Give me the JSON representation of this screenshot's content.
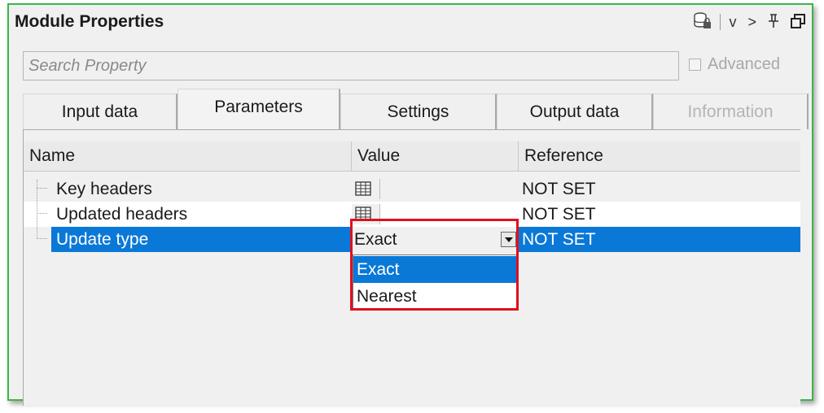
{
  "window": {
    "title": "Module Properties"
  },
  "titlebar_icons": [
    {
      "name": "database-lock-icon"
    },
    {
      "name": "chevron-down-icon",
      "glyph": "v"
    },
    {
      "name": "chevron-right-icon",
      "glyph": ">"
    },
    {
      "name": "pin-icon",
      "glyph": "⊥"
    },
    {
      "name": "restore-window-icon",
      "glyph": "❐"
    }
  ],
  "search": {
    "placeholder": "Search Property",
    "value": ""
  },
  "advanced": {
    "label": "Advanced",
    "checked": false,
    "enabled": false
  },
  "tabs": [
    {
      "label": "Input data",
      "active": false,
      "enabled": true
    },
    {
      "label": "Parameters",
      "active": true,
      "enabled": true
    },
    {
      "label": "Settings",
      "active": false,
      "enabled": true
    },
    {
      "label": "Output data",
      "active": false,
      "enabled": true
    },
    {
      "label": "Information",
      "active": false,
      "enabled": false
    }
  ],
  "grid": {
    "columns": [
      "Name",
      "Value",
      "Reference"
    ],
    "rows": [
      {
        "name": "Key headers",
        "value_type": "table-editor",
        "reference": "NOT SET",
        "selected": false
      },
      {
        "name": "Updated headers",
        "value_type": "table-editor",
        "reference": "NOT SET",
        "selected": false
      },
      {
        "name": "Update type",
        "value_type": "dropdown",
        "value": "Exact",
        "reference": "NOT SET",
        "selected": true
      }
    ]
  },
  "dropdown": {
    "options": [
      "Exact",
      "Nearest"
    ],
    "selected": "Exact"
  },
  "colors": {
    "selection": "#0a78d7",
    "frame_border": "#3cb44b",
    "highlight": "#e0101e"
  }
}
